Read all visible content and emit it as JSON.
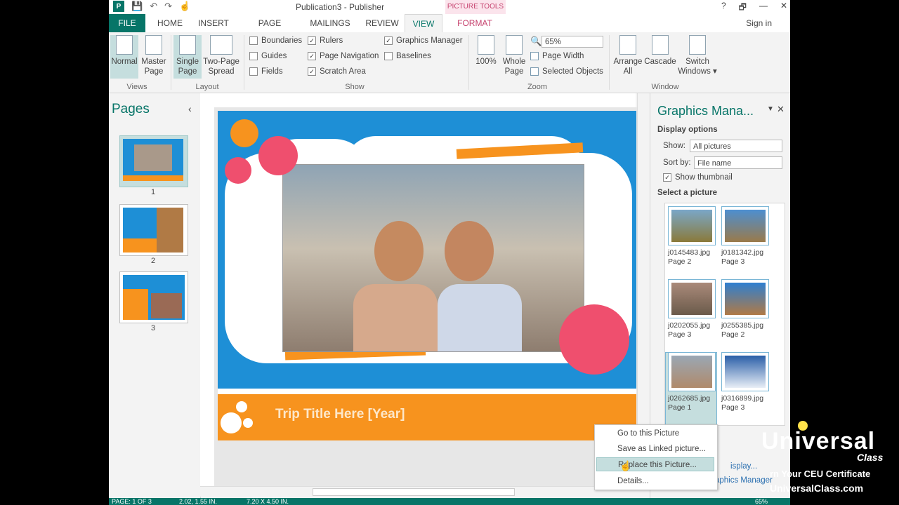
{
  "window": {
    "title": "Publication3 - Publisher",
    "picture_tools": "PICTURE TOOLS",
    "help": "?",
    "restore": "🗗",
    "min": "—",
    "close": "✕",
    "sign_in": "Sign in",
    "logo": "P"
  },
  "qat": {
    "save": "💾",
    "undo": "↶",
    "redo": "↷",
    "touch": "☝"
  },
  "tabs": {
    "file": "FILE",
    "home": "HOME",
    "insert": "INSERT",
    "page_design": "PAGE DESIGN",
    "mailings": "MAILINGS",
    "review": "REVIEW",
    "view": "VIEW",
    "format": "FORMAT"
  },
  "ribbon": {
    "views": {
      "normal": "Normal",
      "master1": "Master",
      "master2": "Page",
      "group": "Views"
    },
    "layout": {
      "single1": "Single",
      "single2": "Page",
      "two1": "Two-Page",
      "two2": "Spread",
      "group": "Layout"
    },
    "show": {
      "boundaries": "Boundaries",
      "guides": "Guides",
      "fields": "Fields",
      "rulers": "Rulers",
      "page_navigation": "Page Navigation",
      "scratch_area": "Scratch Area",
      "graphics_manager": "Graphics Manager",
      "baselines": "Baselines",
      "group": "Show",
      "check": "✓"
    },
    "zoom": {
      "p100": "100%",
      "whole1": "Whole",
      "whole2": "Page",
      "value": "65%",
      "page_width": "Page Width",
      "selected_objects": "Selected Objects",
      "group": "Zoom"
    },
    "window": {
      "arrange1": "Arrange",
      "arrange2": "All",
      "cascade": "Cascade",
      "switch1": "Switch",
      "switch2": "Windows ▾",
      "group": "Window"
    }
  },
  "pages_pane": {
    "title": "Pages",
    "collapse": "‹",
    "pages": [
      "1",
      "2",
      "3"
    ]
  },
  "document": {
    "trip_title": "Trip Title Here [Year]"
  },
  "graphics_manager": {
    "title": "Graphics Mana...",
    "display_options": "Display options",
    "show_label": "Show:",
    "show_value": "All pictures",
    "sort_label": "Sort by:",
    "sort_value": "File name",
    "show_thumbnail": "Show thumbnail",
    "select_picture": "Select a picture",
    "pictures": [
      {
        "name": "j0145483.jpg",
        "page": "Page 2"
      },
      {
        "name": "j0181342.jpg",
        "page": "Page 3"
      },
      {
        "name": "j0202055.jpg",
        "page": "Page 3"
      },
      {
        "name": "j0255385.jpg",
        "page": "Page 2"
      },
      {
        "name": "j0262685.jpg",
        "page": "Page 1"
      },
      {
        "name": "j0316899.jpg",
        "page": "Page 3"
      }
    ],
    "more_display": "isplay...",
    "footer_link": "aphics Manager"
  },
  "context_menu": {
    "goto": "Go to this Picture",
    "save_linked": "Save as Linked picture...",
    "replace": "Replace this Picture...",
    "details": "Details..."
  },
  "status": {
    "page": "PAGE: 1 OF 3",
    "pos": "2.02, 1.55 IN.",
    "size": "7.20 X 4.50 IN.",
    "zoom": "65%"
  },
  "watermark": {
    "brand": "Universal",
    "class": "Class",
    "ceu": "rn Your CEU Certificate",
    "url": "UniversalClass.com"
  }
}
